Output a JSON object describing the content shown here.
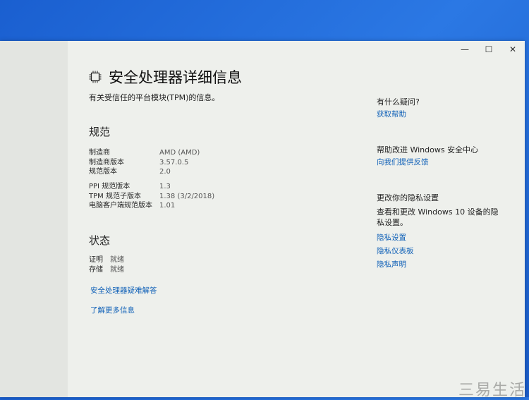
{
  "window_controls": {
    "minimize": "—",
    "maximize": "☐",
    "close": "✕"
  },
  "header": {
    "title": "安全处理器详细信息",
    "subtitle": "有关受信任的平台模块(TPM)的信息。",
    "icon": "chip-icon"
  },
  "spec": {
    "heading": "规范",
    "group1": [
      {
        "label": "制造商",
        "value": "AMD (AMD)"
      },
      {
        "label": "制造商版本",
        "value": "3.57.0.5"
      },
      {
        "label": "规范版本",
        "value": "2.0"
      }
    ],
    "group2": [
      {
        "label": "PPI 规范版本",
        "value": "1.3"
      },
      {
        "label": "TPM 规范子版本",
        "value": "1.38 (3/2/2018)"
      },
      {
        "label": "电脑客户端规范版本",
        "value": "1.01"
      }
    ]
  },
  "status": {
    "heading": "状态",
    "rows": [
      {
        "label": "证明",
        "value": "就绪"
      },
      {
        "label": "存储",
        "value": "就绪"
      }
    ]
  },
  "links": {
    "troubleshoot": "安全处理器疑难解答",
    "learn_more": "了解更多信息"
  },
  "side": {
    "help_heading": "有什么疑问?",
    "help_link": "获取帮助",
    "improve_heading": "帮助改进 Windows 安全中心",
    "feedback_link": "向我们提供反馈",
    "privacy_heading": "更改你的隐私设置",
    "privacy_text": "查看和更改 Windows 10 设备的隐私设置。",
    "privacy_settings": "隐私设置",
    "privacy_dashboard": "隐私仪表板",
    "privacy_statement": "隐私声明"
  },
  "watermark": "三易生活",
  "colors": {
    "link": "#1262b8",
    "desktop": "#2b78e4",
    "window": "#eef0ec"
  }
}
